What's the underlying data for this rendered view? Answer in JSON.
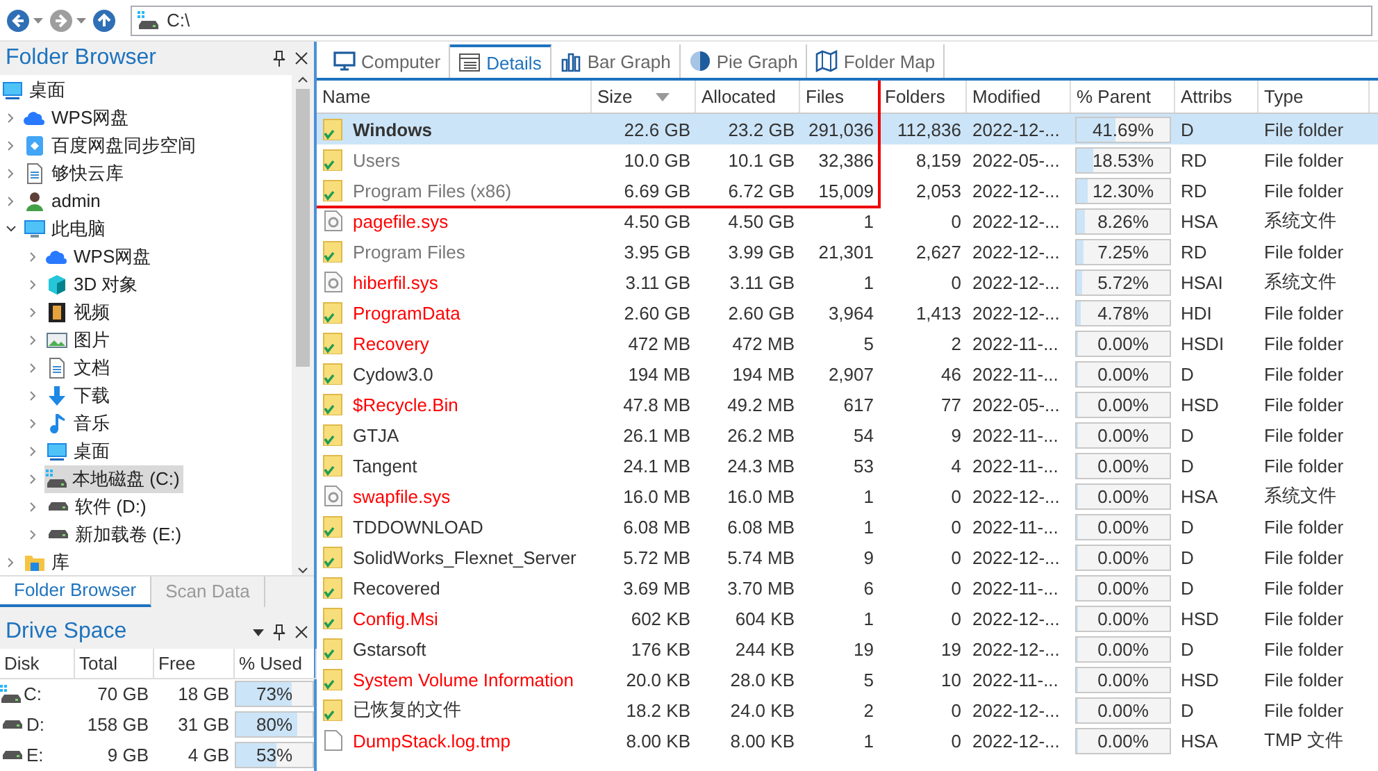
{
  "toolbar": {
    "address": "C:\\"
  },
  "folder_browser": {
    "title": "Folder Browser",
    "tree": [
      {
        "label": "桌面",
        "kind": "desktop",
        "selected": false,
        "children": [
          {
            "label": "WPS网盘",
            "kind": "cloud",
            "selected": false,
            "expanded": false
          },
          {
            "label": "百度网盘同步空间",
            "kind": "sync",
            "selected": false,
            "expanded": false
          },
          {
            "label": "够快云库",
            "kind": "page",
            "selected": false,
            "expanded": false
          },
          {
            "label": "admin",
            "kind": "user",
            "selected": false,
            "expanded": false
          },
          {
            "label": "此电脑",
            "kind": "monitor",
            "selected": false,
            "expanded": true,
            "children": [
              {
                "label": "WPS网盘",
                "kind": "cloud",
                "selected": false,
                "expanded": false
              },
              {
                "label": "3D 对象",
                "kind": "cube",
                "selected": false,
                "expanded": false
              },
              {
                "label": "视频",
                "kind": "film",
                "selected": false,
                "expanded": false
              },
              {
                "label": "图片",
                "kind": "image",
                "selected": false,
                "expanded": false
              },
              {
                "label": "文档",
                "kind": "page",
                "selected": false,
                "expanded": false
              },
              {
                "label": "下载",
                "kind": "download",
                "selected": false,
                "expanded": false
              },
              {
                "label": "音乐",
                "kind": "music",
                "selected": false,
                "expanded": false
              },
              {
                "label": "桌面",
                "kind": "desktop",
                "selected": false,
                "expanded": false
              },
              {
                "label": "本地磁盘 (C:)",
                "kind": "sysdrive",
                "selected": true,
                "expanded": false
              },
              {
                "label": "软件 (D:)",
                "kind": "drive",
                "selected": false,
                "expanded": false
              },
              {
                "label": "新加载卷 (E:)",
                "kind": "drive",
                "selected": false,
                "expanded": false
              }
            ]
          },
          {
            "label": "库",
            "kind": "library",
            "selected": false,
            "expanded": false
          }
        ]
      }
    ],
    "tabs": [
      {
        "label": "Folder Browser",
        "selected": true
      },
      {
        "label": "Scan Data",
        "selected": false
      }
    ]
  },
  "drive_space": {
    "title": "Drive Space",
    "columns": [
      "Disk",
      "Total",
      "Free",
      "% Used"
    ],
    "rows": [
      {
        "disk": "C:",
        "kind": "sysdrive",
        "total": "70 GB",
        "free": "18 GB",
        "level": 0.73,
        "reading": "73%"
      },
      {
        "disk": "D:",
        "kind": "drive",
        "total": "158 GB",
        "free": "31 GB",
        "level": 0.8,
        "reading": "80%"
      },
      {
        "disk": "E:",
        "kind": "drive",
        "total": "9 GB",
        "free": "4 GB",
        "level": 0.53,
        "reading": "53%"
      }
    ]
  },
  "view_tabs": [
    {
      "label": "Computer",
      "kind": "computer",
      "selected": false
    },
    {
      "label": "Details",
      "kind": "details",
      "selected": true
    },
    {
      "label": "Bar Graph",
      "kind": "bars",
      "selected": false
    },
    {
      "label": "Pie Graph",
      "kind": "pie",
      "selected": false
    },
    {
      "label": "Folder Map",
      "kind": "map",
      "selected": false
    }
  ],
  "table": {
    "columns": [
      {
        "label": "Name",
        "sorted": false
      },
      {
        "label": "Size",
        "sorted": true
      },
      {
        "label": "Allocated",
        "sorted": false
      },
      {
        "label": "Files",
        "sorted": false
      },
      {
        "label": "Folders",
        "sorted": false
      },
      {
        "label": "Modified",
        "sorted": false
      },
      {
        "label": "% Parent",
        "sorted": false
      },
      {
        "label": "Attribs",
        "sorted": false
      },
      {
        "label": "Type",
        "sorted": false
      }
    ],
    "rows": [
      {
        "name": "Windows",
        "kind": "folder",
        "hidden": false,
        "muted": false,
        "selected": true,
        "size": "22.6 GB",
        "allocated": "23.2 GB",
        "files": "291,036",
        "folders": "112,836",
        "modified": "2022-12-...",
        "level": 0.4169,
        "parent": "41.69%",
        "attribs": "D",
        "type": "File folder"
      },
      {
        "name": "Users",
        "kind": "folder",
        "hidden": false,
        "muted": true,
        "selected": false,
        "size": "10.0 GB",
        "allocated": "10.1 GB",
        "files": "32,386",
        "folders": "8,159",
        "modified": "2022-05-...",
        "level": 0.1853,
        "parent": "18.53%",
        "attribs": "RD",
        "type": "File folder"
      },
      {
        "name": "Program Files (x86)",
        "kind": "folder",
        "hidden": false,
        "muted": true,
        "selected": false,
        "size": "6.69 GB",
        "allocated": "6.72 GB",
        "files": "15,009",
        "folders": "2,053",
        "modified": "2022-12-...",
        "level": 0.123,
        "parent": "12.30%",
        "attribs": "RD",
        "type": "File folder"
      },
      {
        "name": "pagefile.sys",
        "kind": "sysfile",
        "hidden": true,
        "muted": false,
        "selected": false,
        "size": "4.50 GB",
        "allocated": "4.50 GB",
        "files": "1",
        "folders": "0",
        "modified": "2022-12-...",
        "level": 0.0826,
        "parent": "8.26%",
        "attribs": "HSA",
        "type": "系统文件"
      },
      {
        "name": "Program Files",
        "kind": "folder",
        "hidden": false,
        "muted": true,
        "selected": false,
        "size": "3.95 GB",
        "allocated": "3.99 GB",
        "files": "21,301",
        "folders": "2,627",
        "modified": "2022-12-...",
        "level": 0.0725,
        "parent": "7.25%",
        "attribs": "RD",
        "type": "File folder"
      },
      {
        "name": "hiberfil.sys",
        "kind": "sysfile",
        "hidden": true,
        "muted": false,
        "selected": false,
        "size": "3.11 GB",
        "allocated": "3.11 GB",
        "files": "1",
        "folders": "0",
        "modified": "2022-12-...",
        "level": 0.0572,
        "parent": "5.72%",
        "attribs": "HSAI",
        "type": "系统文件"
      },
      {
        "name": "ProgramData",
        "kind": "folder",
        "hidden": true,
        "muted": false,
        "selected": false,
        "size": "2.60 GB",
        "allocated": "2.60 GB",
        "files": "3,964",
        "folders": "1,413",
        "modified": "2022-12-...",
        "level": 0.0478,
        "parent": "4.78%",
        "attribs": "HDI",
        "type": "File folder"
      },
      {
        "name": "Recovery",
        "kind": "folder",
        "hidden": true,
        "muted": false,
        "selected": false,
        "size": "472 MB",
        "allocated": "472 MB",
        "files": "5",
        "folders": "2",
        "modified": "2022-11-...",
        "level": 0,
        "parent": "0.00%",
        "attribs": "HSDI",
        "type": "File folder"
      },
      {
        "name": "Cydow3.0",
        "kind": "folder",
        "hidden": false,
        "muted": false,
        "selected": false,
        "size": "194 MB",
        "allocated": "194 MB",
        "files": "2,907",
        "folders": "46",
        "modified": "2022-11-...",
        "level": 0,
        "parent": "0.00%",
        "attribs": "D",
        "type": "File folder"
      },
      {
        "name": "$Recycle.Bin",
        "kind": "folder",
        "hidden": true,
        "muted": false,
        "selected": false,
        "size": "47.8 MB",
        "allocated": "49.2 MB",
        "files": "617",
        "folders": "77",
        "modified": "2022-05-...",
        "level": 0,
        "parent": "0.00%",
        "attribs": "HSD",
        "type": "File folder"
      },
      {
        "name": "GTJA",
        "kind": "folder",
        "hidden": false,
        "muted": false,
        "selected": false,
        "size": "26.1 MB",
        "allocated": "26.2 MB",
        "files": "54",
        "folders": "9",
        "modified": "2022-11-...",
        "level": 0,
        "parent": "0.00%",
        "attribs": "D",
        "type": "File folder"
      },
      {
        "name": "Tangent",
        "kind": "folder",
        "hidden": false,
        "muted": false,
        "selected": false,
        "size": "24.1 MB",
        "allocated": "24.3 MB",
        "files": "53",
        "folders": "4",
        "modified": "2022-11-...",
        "level": 0,
        "parent": "0.00%",
        "attribs": "D",
        "type": "File folder"
      },
      {
        "name": "swapfile.sys",
        "kind": "sysfile",
        "hidden": true,
        "muted": false,
        "selected": false,
        "size": "16.0 MB",
        "allocated": "16.0 MB",
        "files": "1",
        "folders": "0",
        "modified": "2022-12-...",
        "level": 0,
        "parent": "0.00%",
        "attribs": "HSA",
        "type": "系统文件"
      },
      {
        "name": "TDDOWNLOAD",
        "kind": "folder",
        "hidden": false,
        "muted": false,
        "selected": false,
        "size": "6.08 MB",
        "allocated": "6.08 MB",
        "files": "1",
        "folders": "0",
        "modified": "2022-11-...",
        "level": 0,
        "parent": "0.00%",
        "attribs": "D",
        "type": "File folder"
      },
      {
        "name": "SolidWorks_Flexnet_Server",
        "kind": "folder",
        "hidden": false,
        "muted": false,
        "selected": false,
        "size": "5.72 MB",
        "allocated": "5.74 MB",
        "files": "9",
        "folders": "0",
        "modified": "2022-12-...",
        "level": 0,
        "parent": "0.00%",
        "attribs": "D",
        "type": "File folder"
      },
      {
        "name": "Recovered",
        "kind": "folder",
        "hidden": false,
        "muted": false,
        "selected": false,
        "size": "3.69 MB",
        "allocated": "3.70 MB",
        "files": "6",
        "folders": "0",
        "modified": "2022-11-...",
        "level": 0,
        "parent": "0.00%",
        "attribs": "D",
        "type": "File folder"
      },
      {
        "name": "Config.Msi",
        "kind": "folder",
        "hidden": true,
        "muted": false,
        "selected": false,
        "size": "602 KB",
        "allocated": "604 KB",
        "files": "1",
        "folders": "0",
        "modified": "2022-12-...",
        "level": 0,
        "parent": "0.00%",
        "attribs": "HSD",
        "type": "File folder"
      },
      {
        "name": "Gstarsoft",
        "kind": "folder",
        "hidden": false,
        "muted": false,
        "selected": false,
        "size": "176 KB",
        "allocated": "244 KB",
        "files": "19",
        "folders": "19",
        "modified": "2022-12-...",
        "level": 0,
        "parent": "0.00%",
        "attribs": "D",
        "type": "File folder"
      },
      {
        "name": "System Volume Information",
        "kind": "folder",
        "hidden": true,
        "muted": false,
        "selected": false,
        "size": "20.0 KB",
        "allocated": "28.0 KB",
        "files": "5",
        "folders": "10",
        "modified": "2022-11-...",
        "level": 0,
        "parent": "0.00%",
        "attribs": "HSD",
        "type": "File folder"
      },
      {
        "name": "已恢复的文件",
        "kind": "folder",
        "hidden": false,
        "muted": false,
        "selected": false,
        "size": "18.2 KB",
        "allocated": "24.0 KB",
        "files": "2",
        "folders": "0",
        "modified": "2022-12-...",
        "level": 0,
        "parent": "0.00%",
        "attribs": "D",
        "type": "File folder"
      },
      {
        "name": "DumpStack.log.tmp",
        "kind": "file",
        "hidden": true,
        "muted": false,
        "selected": false,
        "size": "8.00 KB",
        "allocated": "8.00 KB",
        "files": "1",
        "folders": "0",
        "modified": "2022-12-...",
        "level": 0,
        "parent": "0.00%",
        "attribs": "HSA",
        "type": "TMP 文件"
      }
    ]
  }
}
